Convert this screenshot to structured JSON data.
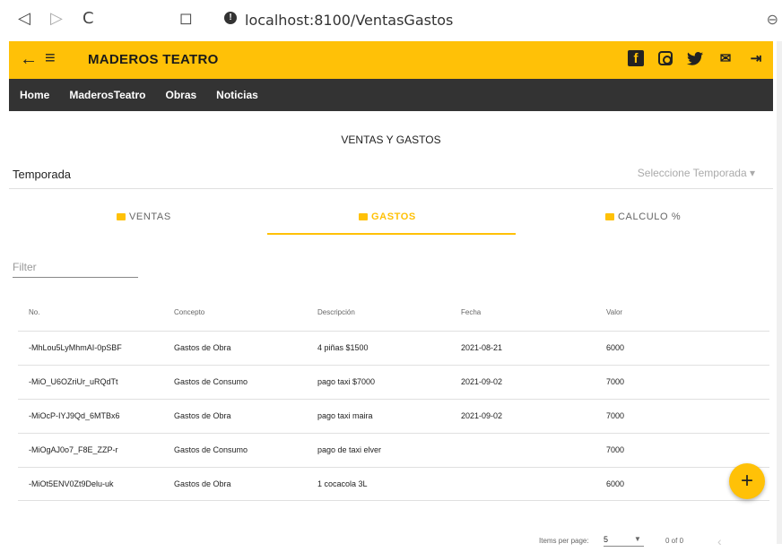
{
  "browser": {
    "url": "localhost:8100/VentasGastos",
    "back_icon": "◁",
    "forward_icon": "▷",
    "reload_icon": "C",
    "bookmark_icon": "◻"
  },
  "appbar": {
    "title": "MADEROS TEATRO",
    "back_icon": "←",
    "menu_icon": "≡",
    "accent": "#ffc107"
  },
  "navbar": {
    "items": [
      "Home",
      "MaderosTeatro",
      "Obras",
      "Noticias"
    ]
  },
  "page": {
    "heading": "VENTAS Y GASTOS",
    "temporada_label": "Temporada",
    "temporada_placeholder": "Seleccione Temporada ▾"
  },
  "tabs": [
    {
      "label": "VENTAS",
      "active": false
    },
    {
      "label": "GASTOS",
      "active": true
    },
    {
      "label": "CALCULO %",
      "active": false
    }
  ],
  "filter": {
    "placeholder": "Filter"
  },
  "table": {
    "columns": [
      "No.",
      "Concepto",
      "Descripción",
      "Fecha",
      "Valor"
    ],
    "rows": [
      [
        "-MhLou5LyMhmAI-0pSBF",
        "Gastos de Obra",
        "4 piñas $1500",
        "2021-08-21",
        "6000"
      ],
      [
        "-MiO_U6OZriUr_uRQdTt",
        "Gastos de Consumo",
        "pago taxi $7000",
        "2021-09-02",
        "7000"
      ],
      [
        "-MiOcP-IYJ9Qd_6MTBx6",
        "Gastos de Obra",
        "pago taxi maira",
        "2021-09-02",
        "7000"
      ],
      [
        "-MiOgAJ0o7_F8E_ZZP-r",
        "Gastos de Consumo",
        "pago de taxi elver",
        "",
        "7000"
      ],
      [
        "-MiOt5ENV0Zt9Delu-uk",
        "Gastos de Obra",
        "1 cocacola 3L",
        "",
        "6000"
      ]
    ]
  },
  "paginator": {
    "items_per_page_label": "Items per page:",
    "page_size": "5",
    "range": "0 of 0"
  },
  "fab": {
    "label": "+"
  }
}
